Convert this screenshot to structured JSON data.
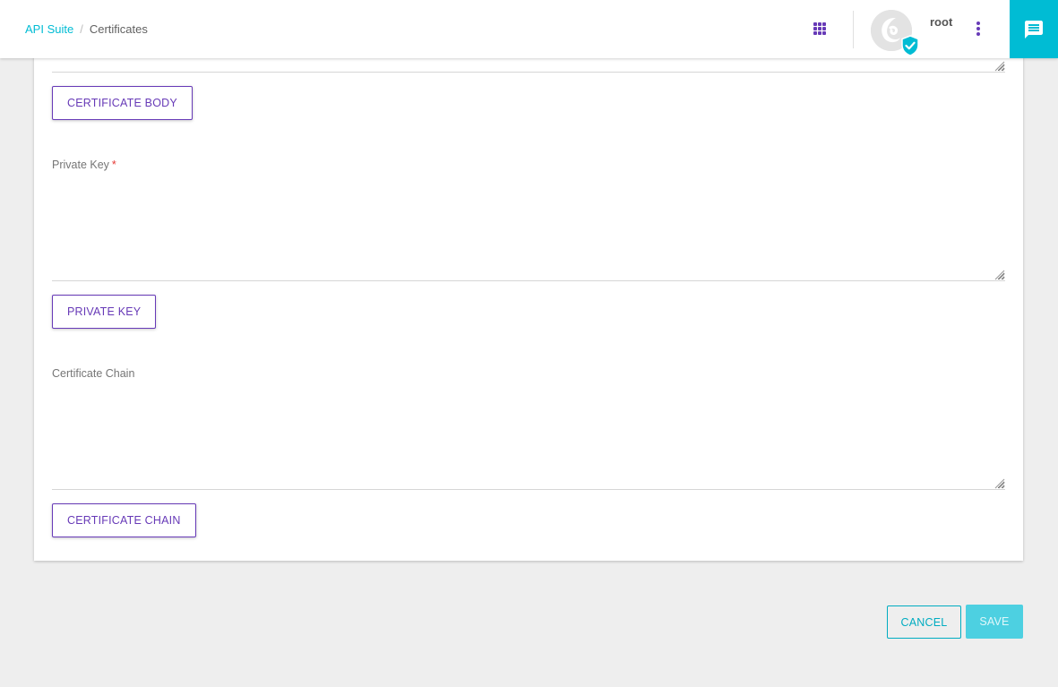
{
  "breadcrumb": {
    "items": [
      "API Suite",
      "Certificates"
    ],
    "separator": "/"
  },
  "header": {
    "apps_icon": "apps-grid-icon",
    "avatar_badge_icon": "verified-shield-icon",
    "username": "root",
    "more_icon": "more-vert-icon",
    "chat_icon": "chat-message-icon"
  },
  "form": {
    "certificate_body": {
      "button_label": "CERTIFICATE BODY",
      "value": ""
    },
    "private_key": {
      "label": "Private Key",
      "required_marker": "*",
      "value": "",
      "button_label": "PRIVATE KEY"
    },
    "certificate_chain": {
      "label": "Certificate Chain",
      "value": "",
      "button_label": "CERTIFICATE CHAIN"
    }
  },
  "actions": {
    "cancel_label": "CANCEL",
    "save_label": "SAVE"
  },
  "colors": {
    "primary": "#673ab7",
    "accent": "#00bcd4",
    "background": "#eeeeee",
    "required": "#e53935"
  }
}
